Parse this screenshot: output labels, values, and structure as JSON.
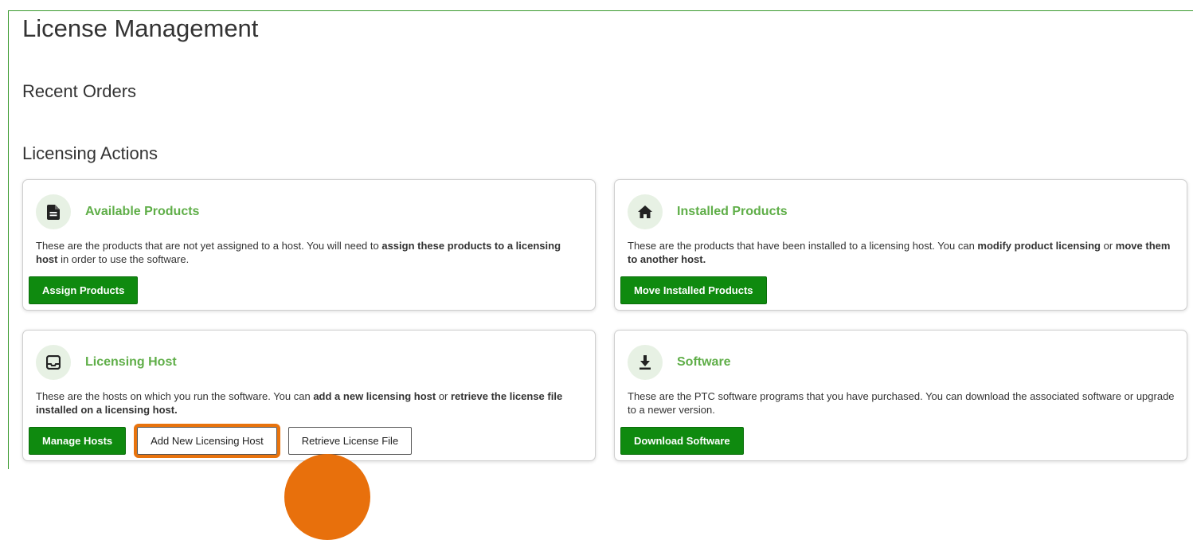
{
  "page": {
    "title": "License Management",
    "recent_orders": "Recent Orders",
    "licensing_actions": "Licensing Actions"
  },
  "colors": {
    "accent_green": "#0f8a0f",
    "title_green": "#5fae48",
    "highlight_orange": "#e8730d"
  },
  "cards": {
    "available": {
      "icon": "document-icon",
      "title": "Available Products",
      "desc_1": "These are the products that are not yet assigned to a host. You will need to ",
      "desc_bold": "assign these products to a licensing host",
      "desc_2": " in order to use the software.",
      "button": "Assign Products"
    },
    "installed": {
      "icon": "home-icon",
      "title": "Installed Products",
      "desc_1": "These are the products that have been installed to a licensing host. You can ",
      "desc_bold": "modify product licensing",
      "desc_2": " or ",
      "desc_bold_2": "move them to another host.",
      "button": "Move Installed Products"
    },
    "host": {
      "icon": "inbox-icon",
      "title": "Licensing Host",
      "desc_1": "These are the hosts on which you run the software. You can ",
      "desc_bold": "add a new licensing host",
      "desc_2": " or ",
      "desc_bold_2": "retrieve the license file installed on a licensing host.",
      "button_manage": "Manage Hosts",
      "button_add": "Add New Licensing Host",
      "button_retrieve": "Retrieve License File"
    },
    "software": {
      "icon": "download-icon",
      "title": "Software",
      "desc": "These are the PTC software programs that you have purchased. You can download the associated software or upgrade to a newer version.",
      "button": "Download Software"
    }
  }
}
